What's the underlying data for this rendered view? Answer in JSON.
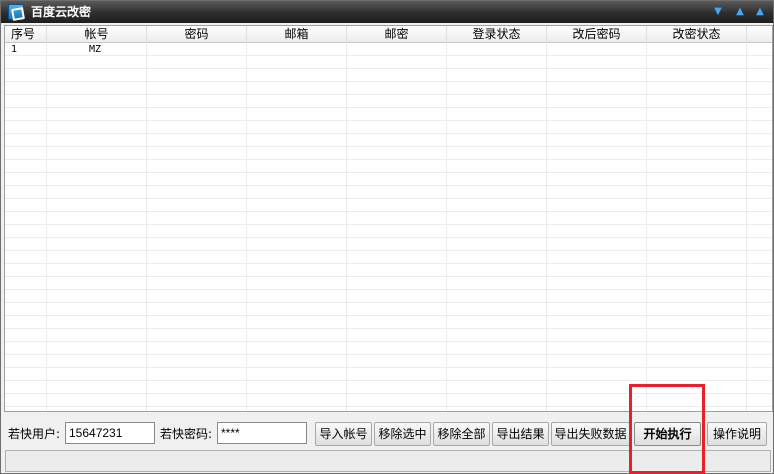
{
  "window": {
    "title": "百度云改密",
    "controls": [
      "chevron-down",
      "chevron-up",
      "chevron-up"
    ]
  },
  "grid": {
    "columns": [
      "序号",
      "帐号",
      "密码",
      "邮箱",
      "邮密",
      "登录状态",
      "改后密码",
      "改密状态"
    ],
    "rows": [
      {
        "index": "1",
        "account": "MZ",
        "password": "",
        "email": "",
        "email_password": "",
        "login_status": "",
        "new_password": "",
        "change_status": ""
      }
    ]
  },
  "form": {
    "user_label": "若快用户:",
    "user_value": "15647231",
    "password_label": "若快密码:",
    "password_value": "****"
  },
  "buttons": {
    "import": "导入帐号",
    "remove_selected": "移除选中",
    "remove_all": "移除全部",
    "export_results": "导出结果",
    "export_failed": "导出失败数据",
    "start": "开始执行",
    "help": "操作说明"
  },
  "colors": {
    "highlight": "#e8202a",
    "titlebar": "#2e2e2e",
    "accent": "#3ea8ff"
  }
}
